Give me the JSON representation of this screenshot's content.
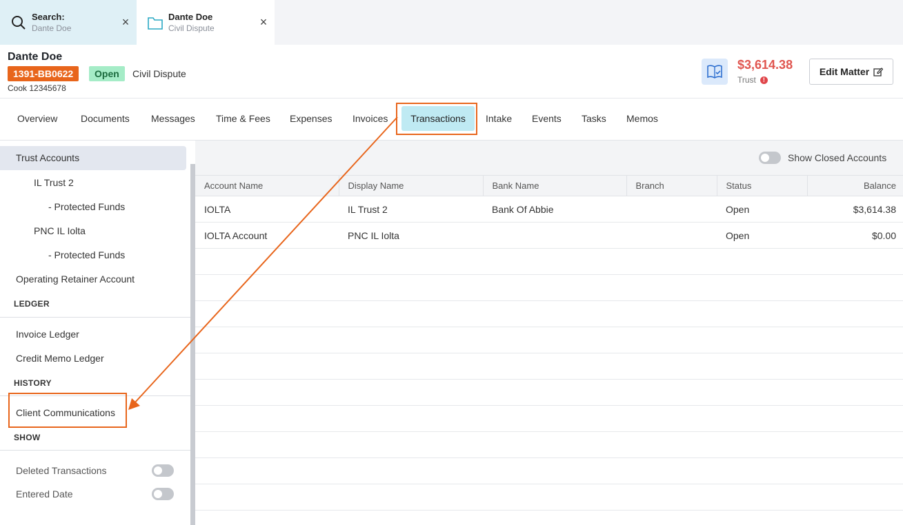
{
  "tabs": [
    {
      "title": "Search:",
      "subtitle": "Dante Doe"
    },
    {
      "title": "Dante Doe",
      "subtitle": "Civil Dispute"
    }
  ],
  "matter": {
    "client_name": "Dante Doe",
    "matter_id": "1391-BB0622",
    "status": "Open",
    "type": "Civil Dispute",
    "responsible": "Cook 12345678",
    "trust_amount": "$3,614.38",
    "trust_label": "Trust",
    "edit_label": "Edit Matter"
  },
  "nav": [
    "Overview",
    "Documents",
    "Messages",
    "Time & Fees",
    "Expenses",
    "Invoices",
    "Transactions",
    "Intake",
    "Events",
    "Tasks",
    "Memos"
  ],
  "sidebar": {
    "trust_accounts": "Trust Accounts",
    "items": [
      "IL Trust 2",
      "- Protected Funds",
      "PNC IL Iolta",
      "- Protected Funds",
      "Operating Retainer Account"
    ],
    "ledger_header": "LEDGER",
    "ledger_items": [
      "Invoice Ledger",
      "Credit Memo Ledger"
    ],
    "history_header": "HISTORY",
    "history_items": [
      "Client Communications"
    ],
    "show_header": "SHOW",
    "show_items": [
      "Deleted Transactions",
      "Entered Date"
    ]
  },
  "main": {
    "show_closed_label": "Show Closed Accounts",
    "columns": [
      "Account Name",
      "Display Name",
      "Bank Name",
      "Branch",
      "Status",
      "Balance"
    ],
    "rows": [
      [
        "IOLTA",
        "IL Trust 2",
        "Bank Of Abbie",
        "",
        "Open",
        "$3,614.38"
      ],
      [
        "IOLTA Account",
        "PNC IL Iolta",
        "",
        "",
        "Open",
        "$0.00"
      ]
    ]
  },
  "colors": {
    "accent_orange": "#e8651b",
    "active_tab_bg": "#bfeaf3",
    "trust_red": "#e0554f"
  }
}
